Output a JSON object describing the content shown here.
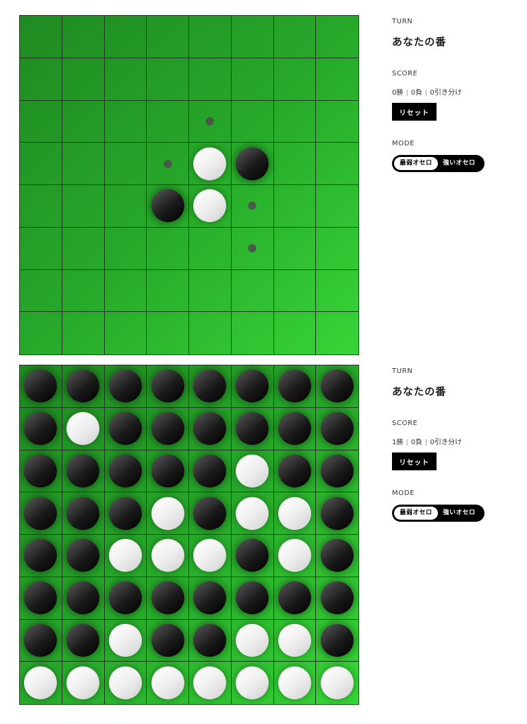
{
  "colors": {
    "board_light": "#37d437",
    "board_dark": "#1f8a22",
    "grid_line": "#1a3a1a",
    "disc_black": "#000000",
    "disc_white": "#ffffff",
    "hint_dot": "#4a5a4a",
    "button_bg": "#000000"
  },
  "games": [
    {
      "board": [
        "........",
        "........",
        "....o...",
        "...oWB..",
        "...BWo..",
        ".....o..",
        "........",
        "........"
      ],
      "panel": {
        "turn_label": "TURN",
        "turn_value": "あなたの番",
        "score_label": "SCORE",
        "wins": "0勝",
        "losses": "0負",
        "draws": "0引き分け",
        "score_separator": "|",
        "reset_label": "リセット",
        "mode_label": "MODE",
        "mode_weak": "最弱オセロ",
        "mode_strong": "強いオセロ",
        "mode_selected": "最弱オセロ"
      }
    },
    {
      "board": [
        "BBBBBBBB",
        "BWBBBBBB",
        "BBBBBWBB",
        "BBBWBWWB",
        "BBWWWBWB",
        "BBBBBBBB",
        "BBWBBWWB",
        "WWWWWWWW"
      ],
      "panel": {
        "turn_label": "TURN",
        "turn_value": "あなたの番",
        "score_label": "SCORE",
        "wins": "1勝",
        "losses": "0負",
        "draws": "0引き分け",
        "score_separator": "|",
        "reset_label": "リセット",
        "mode_label": "MODE",
        "mode_weak": "最弱オセロ",
        "mode_strong": "強いオセロ",
        "mode_selected": "最弱オセロ"
      }
    }
  ]
}
